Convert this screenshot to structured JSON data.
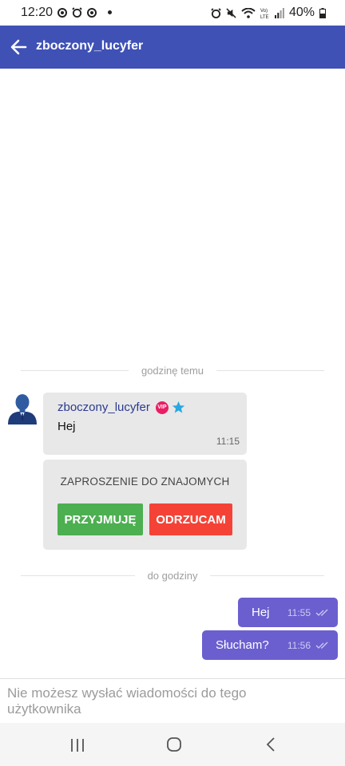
{
  "status_bar": {
    "time": "12:20",
    "battery": "40%",
    "icons": [
      "threads-icon",
      "alarm-icon",
      "threads-icon",
      "dot-icon",
      "alarm-icon",
      "mute-icon",
      "wifi-icon",
      "volte-icon",
      "signal-icon",
      "battery-icon"
    ]
  },
  "app_bar": {
    "title": "zboczony_lucyfer",
    "back_icon": "arrow-left-icon",
    "color": "#3f51b5"
  },
  "separators": {
    "first": "godzinę temu",
    "second": "do godziny"
  },
  "incoming_message": {
    "author": "zboczony_lucyfer",
    "badges": [
      "vip-badge",
      "star-icon"
    ],
    "vip_label": "VIP",
    "text": "Hej",
    "time": "11:15"
  },
  "friend_invite": {
    "title": "ZAPROSZENIE DO ZNAJOMYCH",
    "accept_label": "PRZYJMUJĘ",
    "reject_label": "ODRZUCAM",
    "accept_color": "#4caf50",
    "reject_color": "#f44336"
  },
  "outgoing_messages": [
    {
      "text": "Hej",
      "time": "11:55",
      "status_icon": "double-check-icon"
    },
    {
      "text": "Słucham?",
      "time": "11:56",
      "status_icon": "double-check-icon"
    }
  ],
  "outgoing_color": "#6b5fcf",
  "input_bar": {
    "notice": "Nie możesz wysłać wiadomości do tego użytkownika"
  },
  "nav_bar": {
    "icons": [
      "recents-icon",
      "home-icon",
      "back-icon"
    ]
  }
}
